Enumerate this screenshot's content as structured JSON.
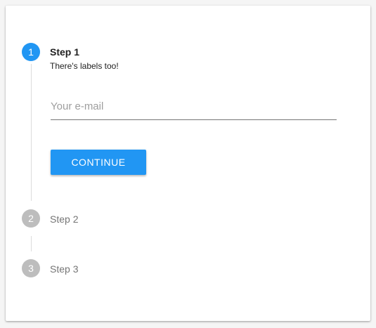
{
  "theme": {
    "accent": "#2196f3",
    "inactive_step": "#bdbdbd"
  },
  "stepper": {
    "steps": [
      {
        "number": "1",
        "title": "Step 1",
        "subtitle": "There's labels too!",
        "state": "active"
      },
      {
        "number": "2",
        "title": "Step 2",
        "state": "inactive"
      },
      {
        "number": "3",
        "title": "Step 3",
        "state": "inactive"
      }
    ]
  },
  "form": {
    "email_placeholder": "Your e-mail",
    "email_value": "",
    "continue_label": "CONTINUE"
  }
}
